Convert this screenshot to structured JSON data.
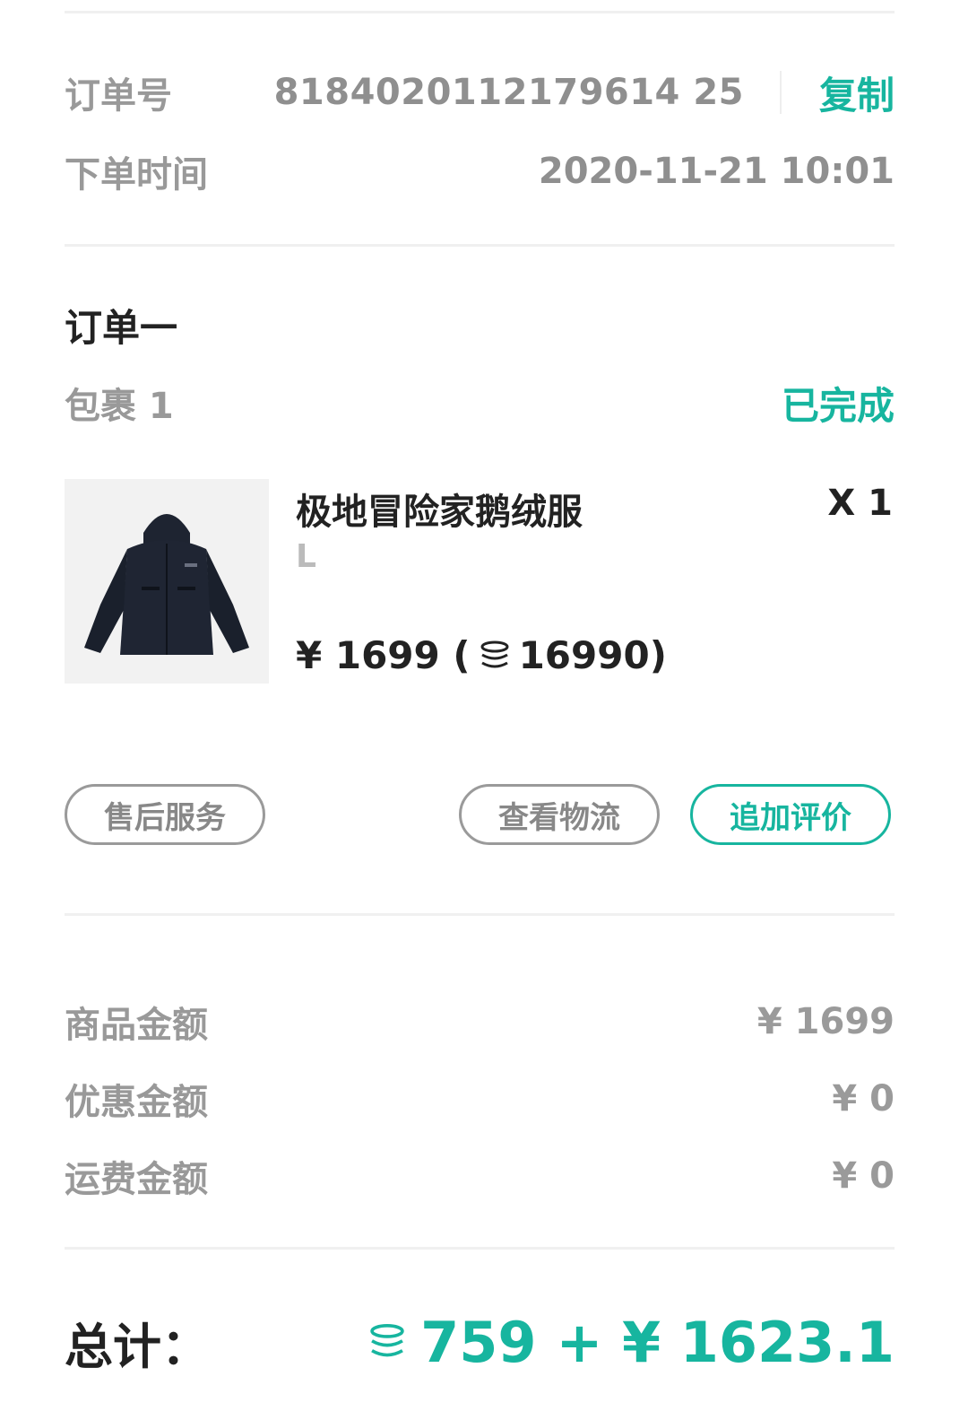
{
  "order": {
    "number_label": "订单号",
    "number_value": "8184020112179614 25",
    "copy_label": "复制",
    "time_label": "下单时间",
    "time_value": "2020-11-21  10:01"
  },
  "suborder": {
    "title": "订单一",
    "package_label": "包裹 1",
    "status": "已完成"
  },
  "product": {
    "name": "极地冒险家鹅绒服",
    "spec": "L",
    "quantity": "X 1",
    "price_prefix": "¥ 1699 (",
    "points": "16990",
    "price_suffix": ")"
  },
  "buttons": {
    "after_sales": "售后服务",
    "logistics": "查看物流",
    "review": "追加评价"
  },
  "amounts": {
    "goods_label": "商品金额",
    "goods_value": "¥ 1699",
    "discount_label": "优惠金额",
    "discount_value": "¥ 0",
    "shipping_label": "运费金额",
    "shipping_value": "¥ 0"
  },
  "total": {
    "label": "总计：",
    "points": "759",
    "plus_money": "+ ¥ 1623.1"
  },
  "colors": {
    "accent": "#17b59f",
    "label_gray": "#999999",
    "dark_text": "#222222"
  },
  "icons": {
    "coin": "coin-stack-icon",
    "product": "jacket-image"
  }
}
